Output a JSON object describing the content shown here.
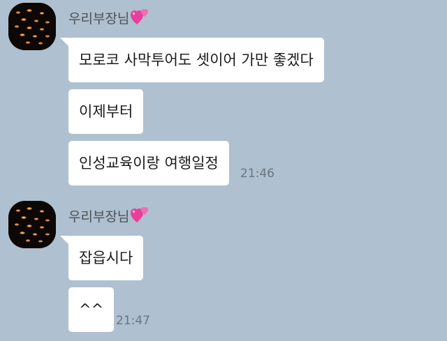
{
  "groups": [
    {
      "sender": "우리부장님",
      "messages": [
        "모로코 사막투어도 셋이어 가만 좋겠다",
        "이제부터",
        "인성교육이랑 여행일정"
      ],
      "time": "21:46"
    },
    {
      "sender": "우리부장님",
      "messages": [
        "잡읍시다",
        "^^"
      ],
      "time": "21:47"
    }
  ],
  "colors": {
    "background": "#afc0d0",
    "bubble": "#ffffff",
    "heart": "#e8409a"
  },
  "icons": {
    "avatar": "dark-profile-photo",
    "name_badge": "two-hearts-emoji"
  }
}
